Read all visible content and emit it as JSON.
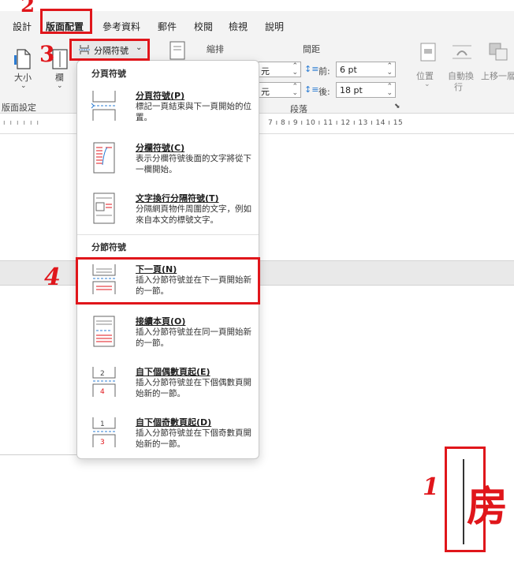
{
  "tabs": [
    {
      "label": "設計"
    },
    {
      "label": "版面配置",
      "active": true
    },
    {
      "label": "參考資料"
    },
    {
      "label": "郵件"
    },
    {
      "label": "校閱"
    },
    {
      "label": "檢視"
    },
    {
      "label": "說明"
    }
  ],
  "ribbon": {
    "size_label": "大小",
    "columns_label": "欄",
    "page_setup_group": "版面設定",
    "breaks_button": "分隔符號",
    "indent_label": "縮排",
    "spacing_label": "間距",
    "indent_unit_1": "元",
    "indent_unit_2": "元",
    "before_label": "前:",
    "before_value": "6 pt",
    "after_label": "後:",
    "after_value": "18 pt",
    "paragraph_group": "段落",
    "position_label": "位置",
    "wrap_label_1": "自動換",
    "wrap_label_2": "行",
    "bring_forward_label": "上移一層"
  },
  "ruler": {
    "numbers": "7  ı  8  ı  9  ı  10  ı  11  ı  12  ı  13  ı  14  ı  15"
  },
  "menu": {
    "section_page": "分頁符號",
    "section_section": "分節符號",
    "items": [
      {
        "title": "分頁符號(P)",
        "desc": "標記一頁結束與下一頁開始的位置。"
      },
      {
        "title": "分欄符號(C)",
        "desc": "表示分欄符號後面的文字將從下一欄開始。"
      },
      {
        "title": "文字換行分隔符號(T)",
        "desc": "分隔網頁物件周圍的文字，例如來自本文的標號文字。"
      },
      {
        "title": "下一頁(N)",
        "desc": "插入分節符號並在下一頁開始新的一節。"
      },
      {
        "title": "接續本頁(O)",
        "desc": "插入分節符號並在同一頁開始新的一節。"
      },
      {
        "title": "自下個偶數頁起(E)",
        "desc": "插入分節符號並在下個偶數頁開始新的一節。"
      },
      {
        "title": "自下個奇數頁起(D)",
        "desc": "插入分節符號並在下個奇數頁開始新的一節。"
      }
    ]
  },
  "annotations": {
    "step1": "1",
    "step2": "2",
    "step3": "3",
    "step4": "4"
  },
  "document": {
    "char": "房"
  },
  "colors": {
    "annotation_red": "#e0161b",
    "ribbon_bg": "#f3f3f3"
  }
}
